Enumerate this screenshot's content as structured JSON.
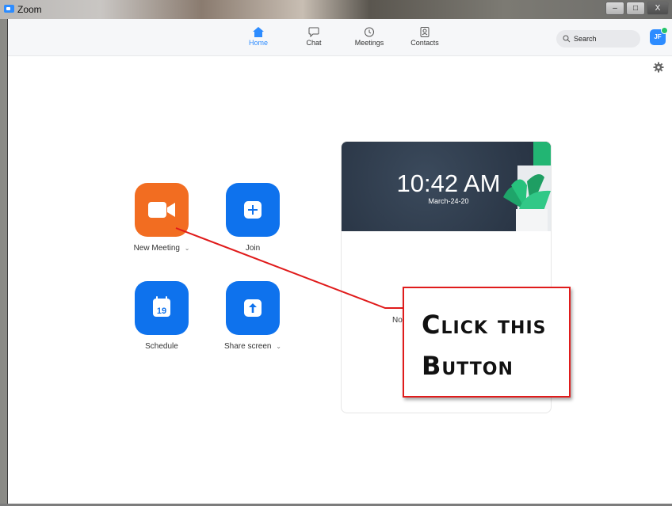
{
  "window": {
    "title": "Zoom",
    "minimize": "–",
    "maximize": "□",
    "close": "X"
  },
  "nav": {
    "items": [
      {
        "label": "Home",
        "icon": "home-icon",
        "active": true
      },
      {
        "label": "Chat",
        "icon": "chat-icon",
        "active": false
      },
      {
        "label": "Meetings",
        "icon": "clock-icon",
        "active": false
      },
      {
        "label": "Contacts",
        "icon": "contacts-icon",
        "active": false
      }
    ],
    "search_placeholder": "Search",
    "avatar_initials": "JF"
  },
  "actions": [
    {
      "label": "New Meeting",
      "has_dropdown": true,
      "icon": "video-camera-icon",
      "color": "#f26d21"
    },
    {
      "label": "Join",
      "has_dropdown": false,
      "icon": "plus-icon",
      "color": "#0e72ed"
    },
    {
      "label": "Schedule",
      "has_dropdown": false,
      "icon": "calendar-icon",
      "calendar_day": "19",
      "color": "#0e72ed"
    },
    {
      "label": "Share screen",
      "has_dropdown": true,
      "icon": "share-up-arrow-icon",
      "color": "#0e72ed"
    }
  ],
  "card": {
    "time": "10:42 AM",
    "date": "March-24-20",
    "empty_text": "No u"
  },
  "annotation": {
    "line1": "Click this",
    "line2": "Button",
    "color": "#e01b1b"
  }
}
